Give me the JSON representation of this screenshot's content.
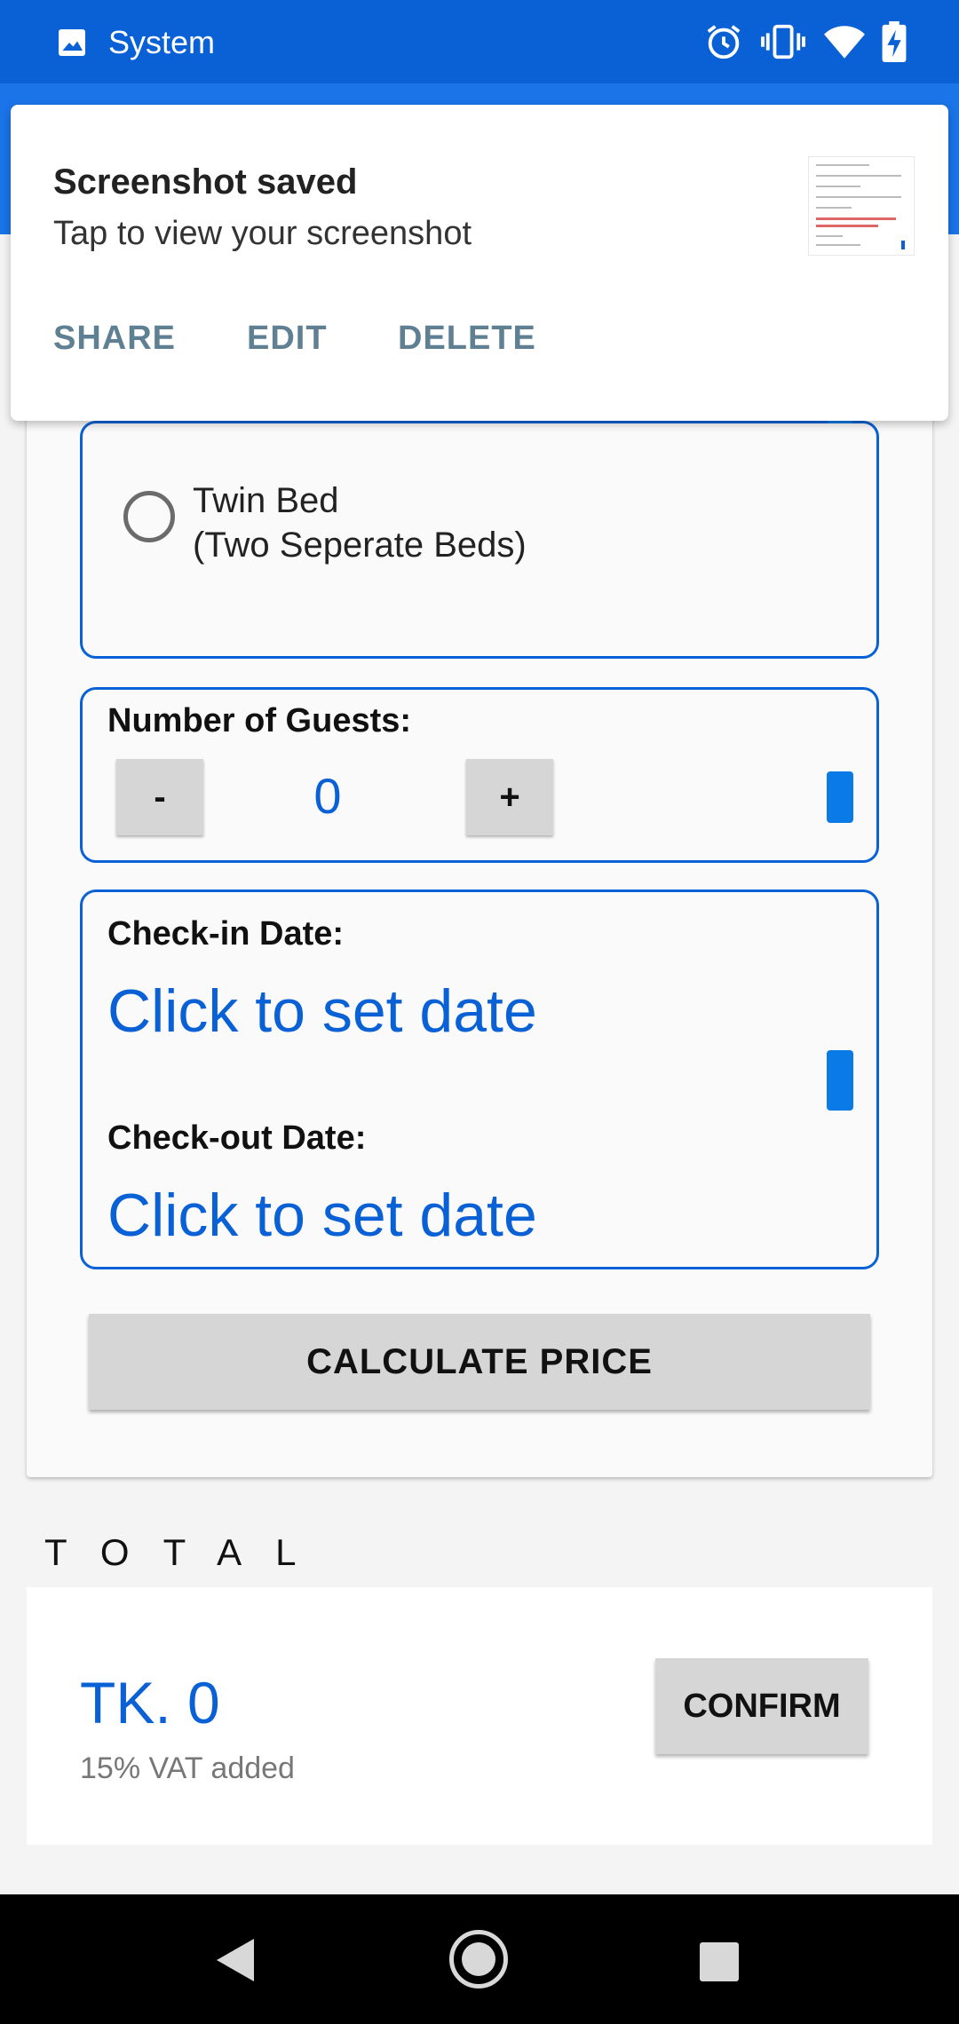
{
  "status_bar": {
    "title": "System",
    "icons": [
      "image-icon",
      "alarm-icon",
      "vibrate-icon",
      "wifi-icon",
      "battery-charging-icon"
    ]
  },
  "form": {
    "bed_option_label_line1": "Twin Bed",
    "bed_option_label_line2": "(Two Seperate Beds)",
    "guests_label": "Number of Guests:",
    "decrement_label": "-",
    "increment_label": "+",
    "guests_value": "0",
    "checkin_label": "Check-in Date:",
    "checkin_value": "Click to set date",
    "checkout_label": "Check-out Date:",
    "checkout_value": "Click to set date",
    "calculate_label": "CALCULATE PRICE"
  },
  "total": {
    "heading": "TOTAL",
    "amount": "TK. 0",
    "vat_note": "15% VAT added",
    "confirm_label": "CONFIRM"
  },
  "notification": {
    "title": "Screenshot saved",
    "subtitle": "Tap to view your screenshot",
    "actions": [
      "SHARE",
      "EDIT",
      "DELETE"
    ]
  },
  "colors": {
    "accent": "#0a61d6",
    "status_bar": "#0a61d6",
    "button_bg": "#d6d6d6",
    "notification_action": "#5f7f93"
  }
}
